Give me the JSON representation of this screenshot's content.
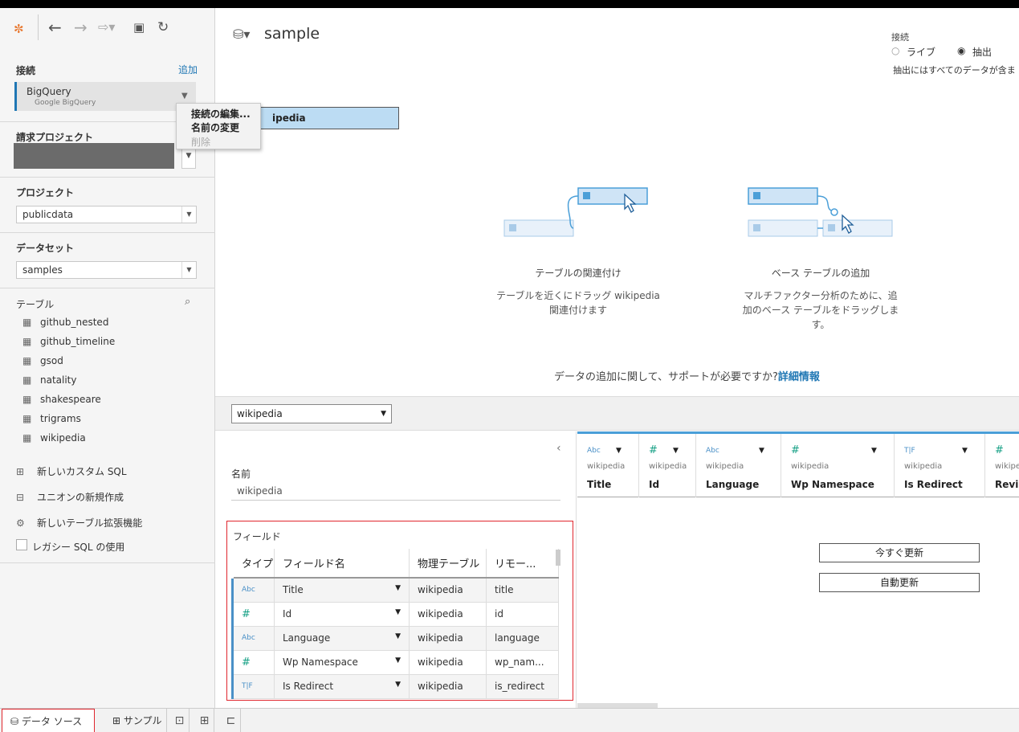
{
  "toolbar": {
    "icons": [
      "tableau-logo-icon",
      "back-arrow-icon",
      "forward-arrow-icon",
      "redo-icon",
      "save-icon",
      "refresh-icon"
    ]
  },
  "left": {
    "connection_title": "接続",
    "add_label": "追加",
    "connection_name": "BigQuery",
    "connection_sub": "Google BigQuery",
    "context_menu": [
      "接続の編集...",
      "名前の変更",
      "削除"
    ],
    "billing_title": "請求プロジェクト",
    "project_title": "プロジェクト",
    "project_value": "publicdata",
    "dataset_title": "データセット",
    "dataset_value": "samples",
    "table_title": "テーブル",
    "tables": [
      "github_nested",
      "github_timeline",
      "gsod",
      "natality",
      "shakespeare",
      "trigrams",
      "wikipedia"
    ],
    "actions": [
      "新しいカスタム SQL",
      "ユニオンの新規作成",
      "新しいテーブル拡張機能"
    ],
    "legacy_sql": "レガシー SQL の使用"
  },
  "canvas": {
    "title": "sample",
    "connection_mode_label": "接続",
    "mode_live": "ライブ",
    "mode_extract": "抽出",
    "selected_mode": "抽出",
    "extract_note": "抽出にはすべてのデータが含ま",
    "table_name": "ipedia",
    "help1_title": "テーブルの関連付け",
    "help1_desc_line1": "テーブルを近くにドラッグ wikipedia",
    "help1_desc_line2": "関連付けます",
    "help2_title": "ベース テーブルの追加",
    "help2_desc_line1": "マルチファクター分析のために、追",
    "help2_desc_line2": "加のベース テーブルをドラッグしま",
    "help2_desc_line3": "す。",
    "support_text": "データの追加に関して、サポートが必要ですか?",
    "support_link": "詳細情報"
  },
  "bottom": {
    "table_select": "wikipedia",
    "name_label": "名前",
    "name_value": "wikipedia",
    "fields_title": "フィールド",
    "field_headers": [
      "タイプ",
      "フィールド名",
      "物理テーブル",
      "リモー..."
    ],
    "fields": [
      {
        "type": "Abc",
        "name": "Title",
        "table": "wikipedia",
        "remote": "title"
      },
      {
        "type": "#",
        "name": "Id",
        "table": "wikipedia",
        "remote": "id"
      },
      {
        "type": "Abc",
        "name": "Language",
        "table": "wikipedia",
        "remote": "language"
      },
      {
        "type": "#",
        "name": "Wp Namespace",
        "table": "wikipedia",
        "remote": "wp_nam..."
      },
      {
        "type": "T|F",
        "name": "Is Redirect",
        "table": "wikipedia",
        "remote": "is_redirect"
      }
    ],
    "grid_columns": [
      {
        "type": "Abc",
        "source": "wikipedia",
        "name": "Title"
      },
      {
        "type": "#",
        "source": "wikipedia",
        "name": "Id"
      },
      {
        "type": "Abc",
        "source": "wikipedia",
        "name": "Language"
      },
      {
        "type": "#",
        "source": "wikipedia",
        "name": "Wp Namespace"
      },
      {
        "type": "T|F",
        "source": "wikipedia",
        "name": "Is Redirect"
      },
      {
        "type": "#",
        "source": "wikipe",
        "name": "Revis"
      }
    ],
    "update_now": "今すぐ更新",
    "auto_update": "自動更新"
  },
  "statusbar": {
    "datasource_tab": "データ ソース",
    "sample_tab": "サンプル"
  }
}
